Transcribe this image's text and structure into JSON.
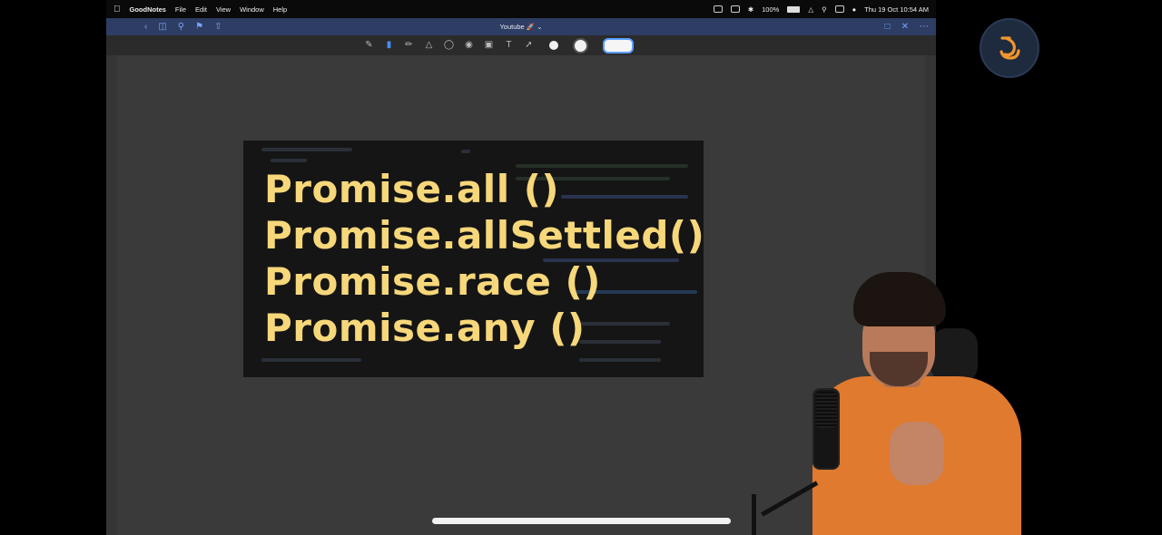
{
  "menubar": {
    "app_name": "GoodNotes",
    "menus": [
      "File",
      "Edit",
      "View",
      "Window",
      "Help"
    ],
    "battery": "100%",
    "datetime": "Thu 19 Oct  10:54 AM"
  },
  "titlebar": {
    "document_title": "Youtube 🚀 ⌄"
  },
  "toolbar": {
    "tools": [
      "pen-icon",
      "eraser-icon",
      "highlighter-icon",
      "shapes-icon",
      "lasso-icon",
      "elements-icon",
      "image-icon",
      "text-icon",
      "laser-icon"
    ],
    "active_tool": "eraser-icon",
    "colors": {
      "primary": "#f2f2f2",
      "accent": "#4a8cff"
    }
  },
  "slide": {
    "lines": [
      "Promise.all ()",
      "Promise.allSettled()",
      "Promise.race ()",
      "Promise.any ()"
    ],
    "text_color": "#f6d77a"
  },
  "logo": {
    "icon": "channel-logo-icon",
    "accent": "#f0962e"
  }
}
